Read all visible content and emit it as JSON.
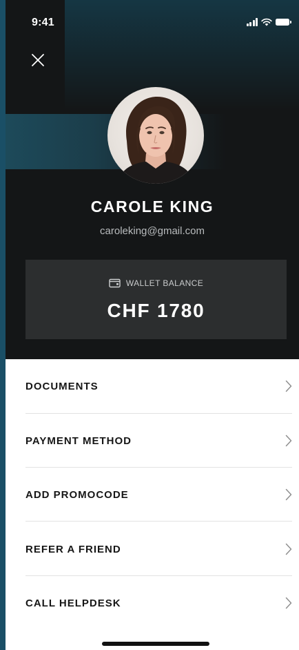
{
  "status_bar": {
    "time": "9:41"
  },
  "profile": {
    "name": "CAROLE KING",
    "email": "caroleking@gmail.com"
  },
  "wallet": {
    "label": "WALLET BALANCE",
    "amount": "CHF 1780"
  },
  "menu": {
    "items": [
      {
        "label": "DOCUMENTS"
      },
      {
        "label": "PAYMENT METHOD"
      },
      {
        "label": "ADD PROMOCODE"
      },
      {
        "label": "REFER A FRIEND"
      },
      {
        "label": "CALL HELPDESK"
      }
    ]
  },
  "icons": {
    "close": "close-icon",
    "wallet": "wallet-icon",
    "chevron": "chevron-right-icon",
    "signal": "cellular-signal-icon",
    "wifi": "wifi-icon",
    "battery": "battery-icon"
  },
  "colors": {
    "dark_background": "#141617",
    "accent_teal": "#1d4a5a",
    "wallet_card": "#2c2e2f",
    "menu_text": "#161616",
    "divider": "#e2e2e2"
  }
}
